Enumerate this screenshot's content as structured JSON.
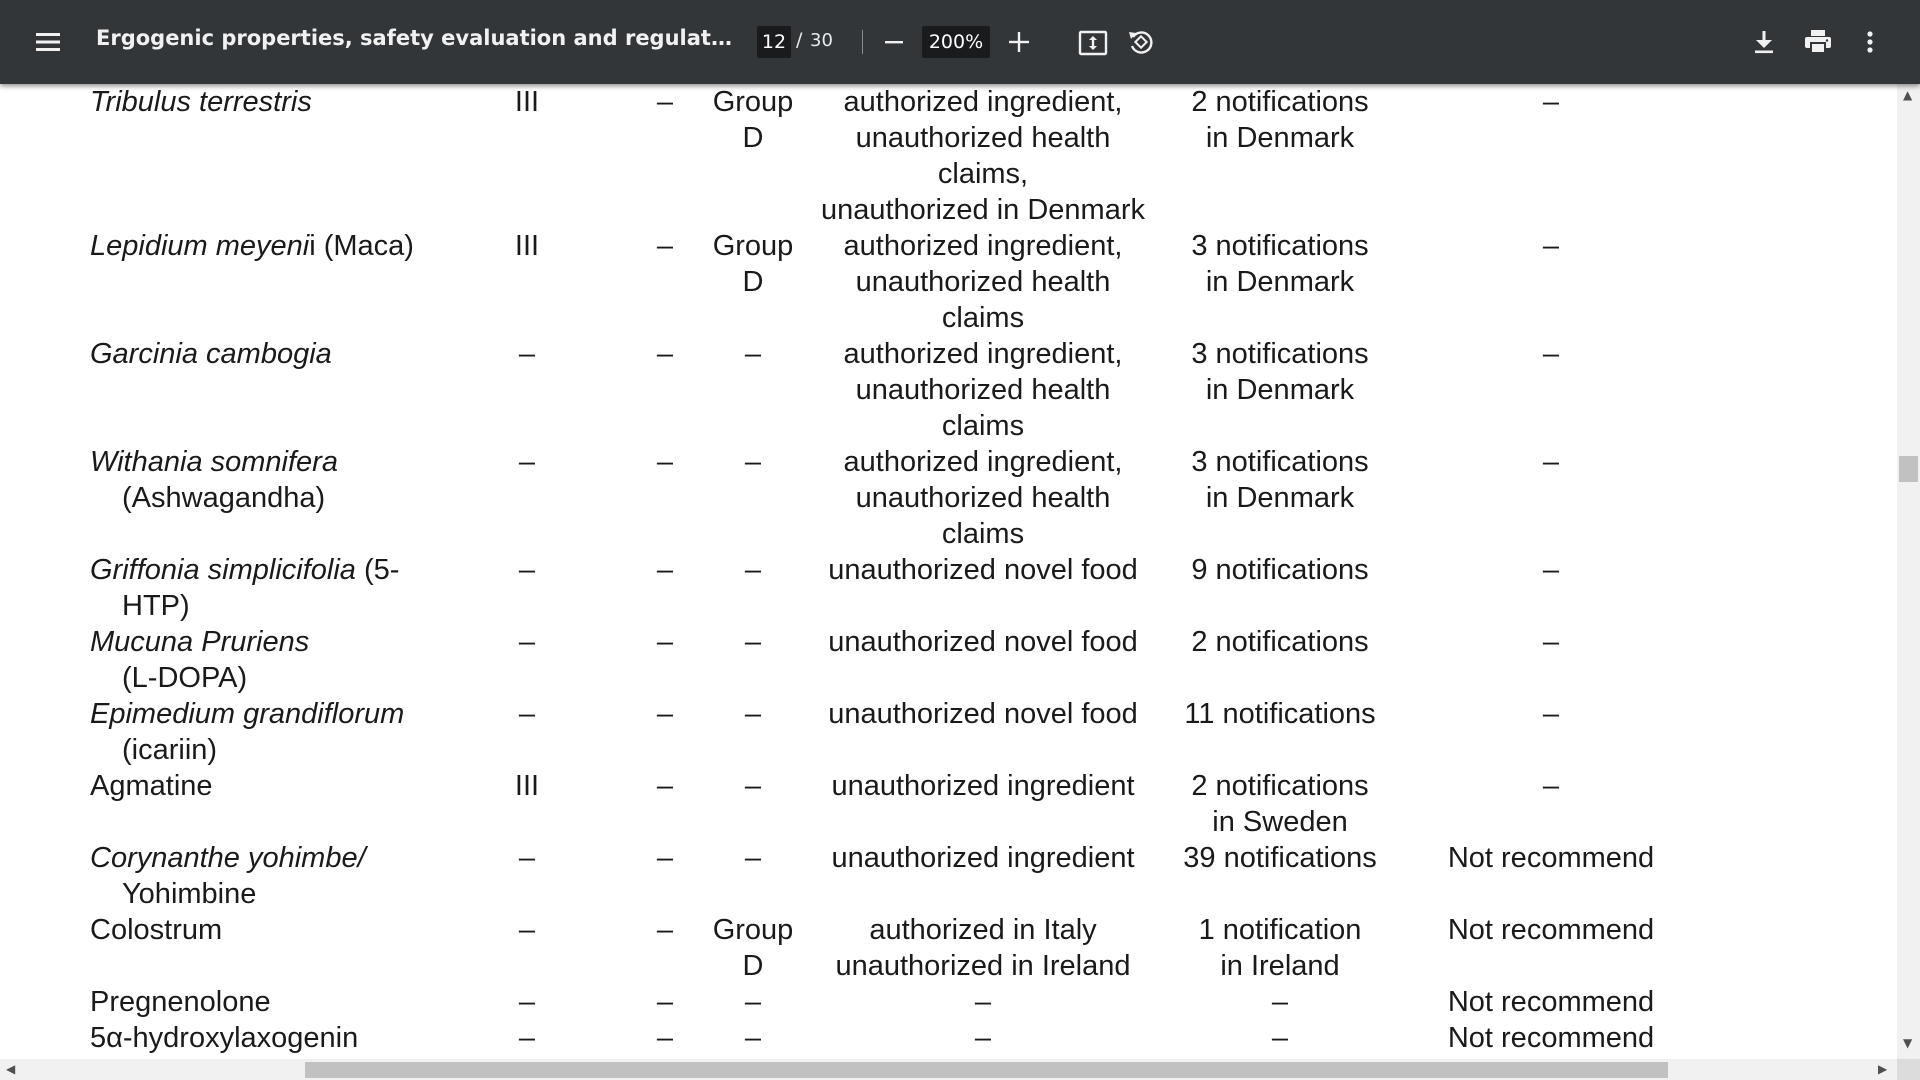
{
  "toolbar": {
    "menu_icon": "hamburger-menu-icon",
    "title": "Ergogenic properties, safety evaluation and regulations of select...",
    "page_current": "12",
    "page_separator": "/",
    "page_total": "30",
    "zoom_out_icon": "minus-icon",
    "zoom_level": "200%",
    "zoom_in_icon": "plus-icon",
    "fit_icon": "fit-to-page-icon",
    "rotate_icon": "rotate-icon",
    "download_icon": "download-icon",
    "print_icon": "print-icon",
    "more_icon": "more-vert-icon"
  },
  "table": {
    "rows": [
      {
        "name": [
          "Tribulus terrestris"
        ],
        "name_italic": [
          true
        ],
        "c1": "III",
        "c2": "–",
        "c3": [
          "Group",
          "D"
        ],
        "c4": [
          "authorized ingredient,",
          "unauthorized health",
          "claims,",
          "unauthorized in Denmark"
        ],
        "c5": [
          "2 notifications",
          "in Denmark"
        ],
        "c6": [
          "–"
        ]
      },
      {
        "name": [
          "Lepidium meyenii (Maca)"
        ],
        "c1": "III",
        "c2": "–",
        "c3": [
          "Group",
          "D"
        ],
        "c4": [
          "authorized ingredient,",
          "unauthorized health",
          "claims"
        ],
        "c5": [
          "3 notifications",
          "in Denmark"
        ],
        "c6": [
          "–"
        ]
      },
      {
        "name": [
          "Garcinia cambogia"
        ],
        "name_italic": [
          true
        ],
        "c1": "–",
        "c2": "–",
        "c3": [
          "–"
        ],
        "c4": [
          "authorized ingredient,",
          "unauthorized health",
          "claims"
        ],
        "c5": [
          "3 notifications",
          "in Denmark"
        ],
        "c6": [
          "–"
        ]
      },
      {
        "name": [
          "Withania somnifera",
          "(Ashwagandha)"
        ],
        "name_italic": [
          true,
          false
        ],
        "c1": "–",
        "c2": "–",
        "c3": [
          "–"
        ],
        "c4": [
          "authorized ingredient,",
          "unauthorized health",
          "claims"
        ],
        "c5": [
          "3 notifications",
          "in Denmark"
        ],
        "c6": [
          "–"
        ]
      },
      {
        "name": [
          "Griffonia simplicifolia (5-",
          "HTP)"
        ],
        "c1": "–",
        "c2": "–",
        "c3": [
          "–"
        ],
        "c4": [
          "unauthorized novel food"
        ],
        "c5": [
          "9 notifications"
        ],
        "c6": [
          "–"
        ]
      },
      {
        "name": [
          "Mucuna Pruriens",
          "(L-DOPA)"
        ],
        "name_italic": [
          true,
          false
        ],
        "c1": "–",
        "c2": "–",
        "c3": [
          "–"
        ],
        "c4": [
          "unauthorized novel food"
        ],
        "c5": [
          "2 notifications"
        ],
        "c6": [
          "–"
        ]
      },
      {
        "name": [
          "Epimedium grandiflorum",
          "(icariin)"
        ],
        "name_italic": [
          true,
          false
        ],
        "c1": "–",
        "c2": "–",
        "c3": [
          "–"
        ],
        "c4": [
          "unauthorized novel food"
        ],
        "c5": [
          "11 notifications"
        ],
        "c6": [
          "–"
        ]
      },
      {
        "name": [
          "Agmatine"
        ],
        "name_italic": [
          false
        ],
        "c1": "III",
        "c2": "–",
        "c3": [
          "–"
        ],
        "c4": [
          "unauthorized ingredient"
        ],
        "c5": [
          "2 notifications",
          "in Sweden"
        ],
        "c6": [
          "–"
        ]
      },
      {
        "name": [
          "Corynanthe yohimbe/",
          "Yohimbine"
        ],
        "name_italic": [
          true,
          false
        ],
        "c1": "–",
        "c2": "–",
        "c3": [
          "–"
        ],
        "c4": [
          "unauthorized ingredient"
        ],
        "c5": [
          "39 notifications"
        ],
        "c6": [
          "Not recommend"
        ]
      },
      {
        "name": [
          "Colostrum"
        ],
        "name_italic": [
          false
        ],
        "c1": "–",
        "c2": "–",
        "c3": [
          "Group",
          "D"
        ],
        "c4": [
          "authorized in Italy",
          "unauthorized in Ireland"
        ],
        "c5": [
          "1 notification",
          "in Ireland"
        ],
        "c6": [
          "Not recommend"
        ]
      },
      {
        "name": [
          "Pregnenolone"
        ],
        "name_italic": [
          false
        ],
        "c1": "–",
        "c2": "–",
        "c3": [
          "–"
        ],
        "c4": [
          "–"
        ],
        "c5": [
          "–"
        ],
        "c6": [
          "Not recommend"
        ]
      },
      {
        "name": [
          "5α-hydroxylaxogenin"
        ],
        "name_italic": [
          false
        ],
        "c1": "–",
        "c2": "–",
        "c3": [
          "–"
        ],
        "c4": [
          "–"
        ],
        "c5": [
          "–"
        ],
        "c6": [
          "Not recommend"
        ]
      }
    ]
  },
  "name_parts": {
    "lepidium_italic": "Lepidium meyeni",
    "lepidium_plain": "i (Maca)",
    "griffonia_italic": "Griffonia simplicifolia",
    "griffonia_plain": " (5-"
  },
  "scrollbars": {
    "up_arrow": "▲",
    "down_arrow": "▼",
    "left_arrow": "◀",
    "right_arrow": "▶"
  }
}
